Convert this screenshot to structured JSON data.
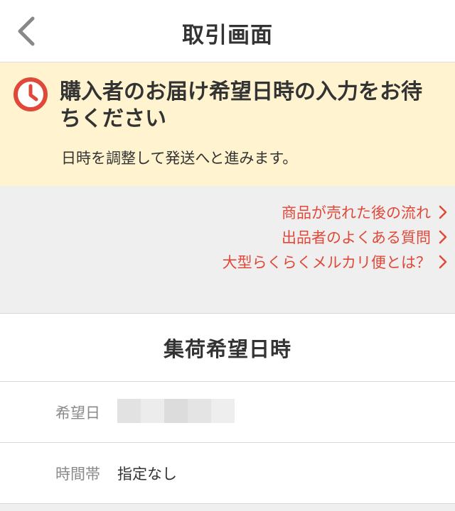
{
  "nav": {
    "title": "取引画面"
  },
  "notice": {
    "title": "購入者のお届け希望日時の入力をお待ちください",
    "subtitle": "日時を調整して発送へと進みます。"
  },
  "links": [
    {
      "label": "商品が売れた後の流れ"
    },
    {
      "label": "出品者のよくある質問"
    },
    {
      "label": "大型らくらくメルカリ便とは？"
    }
  ],
  "section": {
    "title": "集荷希望日時"
  },
  "rows": [
    {
      "label": "希望日",
      "value": ""
    },
    {
      "label": "時間帯",
      "value": "指定なし"
    }
  ],
  "colors": {
    "accent": "#e0493a",
    "notice_bg": "#fff4cf",
    "page_bg": "#efefef"
  },
  "icons": {
    "back": "chevron-left-icon",
    "clock": "clock-icon",
    "link": "chevron-right-icon"
  }
}
